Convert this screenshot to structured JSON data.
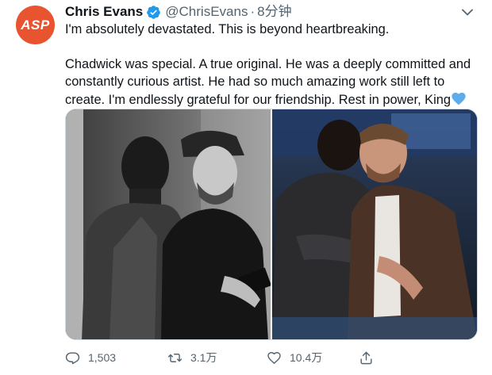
{
  "avatar": {
    "label": "ASP",
    "color": "#e8542f"
  },
  "author": {
    "name": "Chris Evans",
    "handle": "@ChrisEvans",
    "separator": "·",
    "time": "8分钟",
    "verified_icon": "verified-badge-icon"
  },
  "tweet": {
    "line1": "I'm absolutely devastated. This is beyond heartbreaking.",
    "line2": "Chadwick was special. A true original. He was a deeply committed and constantly curious artist. He had so much amazing work still left to create. I'm endlessly grateful for our friendship. Rest in power, King",
    "emoji_icon": "blue-heart-icon"
  },
  "media": {
    "photos": [
      "photo-left",
      "photo-right"
    ]
  },
  "actions": {
    "reply_count": "1,503",
    "retweet_count": "3.1万",
    "like_count": "10.4万",
    "icons": [
      "reply-icon",
      "retweet-icon",
      "like-icon",
      "share-icon"
    ]
  },
  "colors": {
    "accent": "#1d9bf0",
    "text": "#0f1419",
    "secondary": "#536471"
  }
}
